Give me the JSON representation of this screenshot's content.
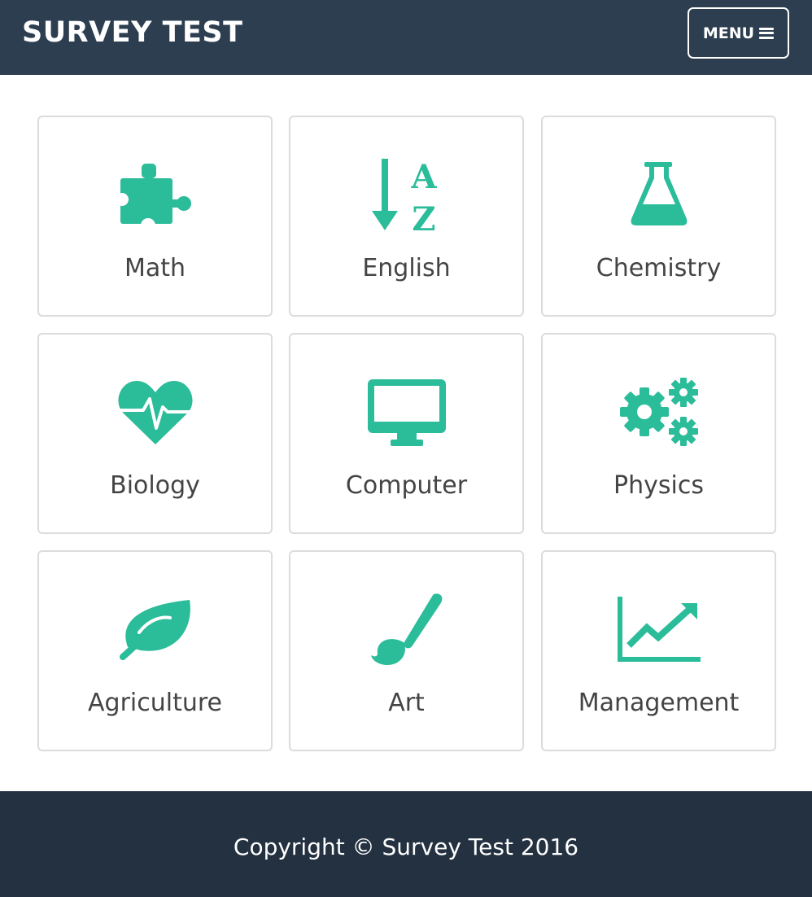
{
  "header": {
    "brand": "SURVEY TEST",
    "menu_label": "MENU",
    "menu_icon": "hamburger-icon"
  },
  "colors": {
    "navbar": "#2c3e50",
    "footer": "#233140",
    "accent": "#2bbc9a",
    "text": "#444444",
    "card_border": "#dcdcdc"
  },
  "subjects": [
    {
      "label": "Math",
      "icon": "puzzle-icon"
    },
    {
      "label": "English",
      "icon": "sort-alpha-icon"
    },
    {
      "label": "Chemistry",
      "icon": "flask-icon"
    },
    {
      "label": "Biology",
      "icon": "heartbeat-icon"
    },
    {
      "label": "Computer",
      "icon": "desktop-icon"
    },
    {
      "label": "Physics",
      "icon": "gears-icon"
    },
    {
      "label": "Agriculture",
      "icon": "leaf-icon"
    },
    {
      "label": "Art",
      "icon": "paint-brush-icon"
    },
    {
      "label": "Management",
      "icon": "line-chart-icon"
    }
  ],
  "footer": {
    "copyright": "Copyright © Survey Test 2016"
  }
}
